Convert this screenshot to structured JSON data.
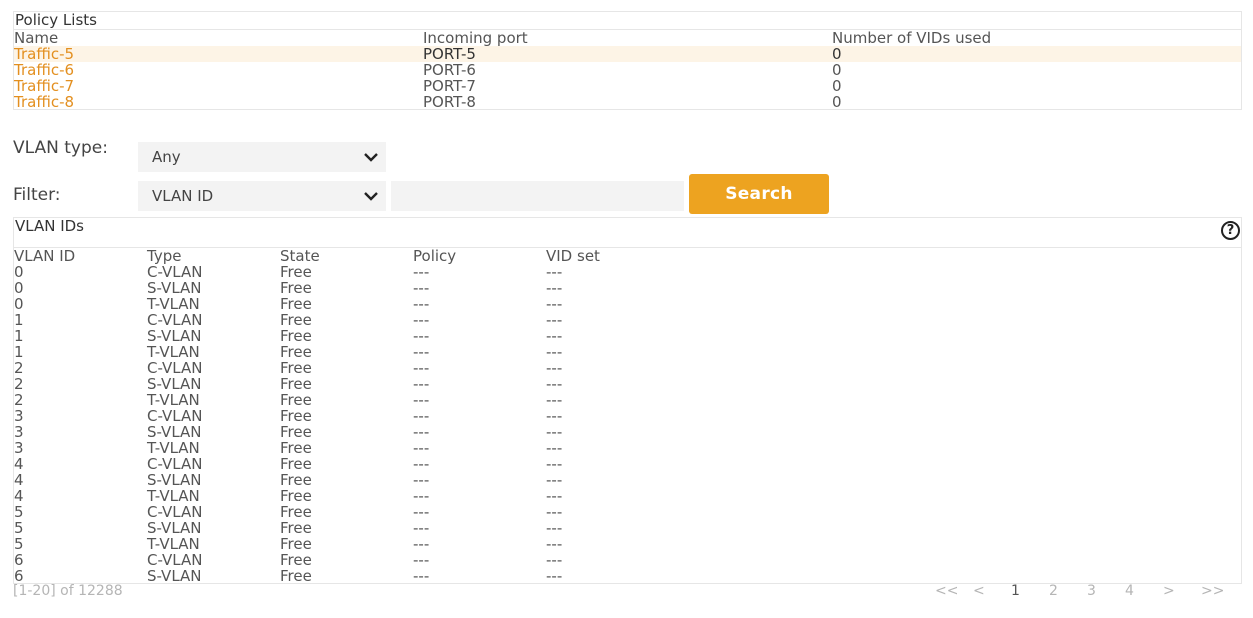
{
  "policy": {
    "title": "Policy Lists",
    "headers": [
      "Name",
      "Incoming port",
      "Number of VIDs used"
    ],
    "rows": [
      {
        "name": "Traffic-5",
        "port": "PORT-5",
        "vids": "0"
      },
      {
        "name": "Traffic-6",
        "port": "PORT-6",
        "vids": "0"
      },
      {
        "name": "Traffic-7",
        "port": "PORT-7",
        "vids": "0"
      },
      {
        "name": "Traffic-8",
        "port": "PORT-8",
        "vids": "0"
      }
    ]
  },
  "form": {
    "vlan_type_label": "VLAN type:",
    "vlan_type_value": "Any",
    "filter_label": "Filter:",
    "filter_value": "VLAN ID",
    "filter_input_value": "",
    "search_label": "Search"
  },
  "vlan": {
    "title": "VLAN IDs",
    "help_icon": "?",
    "headers": [
      "VLAN ID",
      "Type",
      "State",
      "Policy",
      "VID set"
    ],
    "rows": [
      [
        "0",
        "C-VLAN",
        "Free",
        "---",
        "---"
      ],
      [
        "0",
        "S-VLAN",
        "Free",
        "---",
        "---"
      ],
      [
        "0",
        "T-VLAN",
        "Free",
        "---",
        "---"
      ],
      [
        "1",
        "C-VLAN",
        "Free",
        "---",
        "---"
      ],
      [
        "1",
        "S-VLAN",
        "Free",
        "---",
        "---"
      ],
      [
        "1",
        "T-VLAN",
        "Free",
        "---",
        "---"
      ],
      [
        "2",
        "C-VLAN",
        "Free",
        "---",
        "---"
      ],
      [
        "2",
        "S-VLAN",
        "Free",
        "---",
        "---"
      ],
      [
        "2",
        "T-VLAN",
        "Free",
        "---",
        "---"
      ],
      [
        "3",
        "C-VLAN",
        "Free",
        "---",
        "---"
      ],
      [
        "3",
        "S-VLAN",
        "Free",
        "---",
        "---"
      ],
      [
        "3",
        "T-VLAN",
        "Free",
        "---",
        "---"
      ],
      [
        "4",
        "C-VLAN",
        "Free",
        "---",
        "---"
      ],
      [
        "4",
        "S-VLAN",
        "Free",
        "---",
        "---"
      ],
      [
        "4",
        "T-VLAN",
        "Free",
        "---",
        "---"
      ],
      [
        "5",
        "C-VLAN",
        "Free",
        "---",
        "---"
      ],
      [
        "5",
        "S-VLAN",
        "Free",
        "---",
        "---"
      ],
      [
        "5",
        "T-VLAN",
        "Free",
        "---",
        "---"
      ],
      [
        "6",
        "C-VLAN",
        "Free",
        "---",
        "---"
      ],
      [
        "6",
        "S-VLAN",
        "Free",
        "---",
        "---"
      ]
    ]
  },
  "pager": {
    "info": "[1-20] of 12288",
    "first": "<<",
    "prev": "<",
    "pages": [
      "1",
      "2",
      "3",
      "4"
    ],
    "current": "1",
    "next": ">",
    "last": ">>"
  },
  "colors": {
    "accent": "#eda320",
    "link": "#e38f1f",
    "row_highlight": "#fdf4e6"
  }
}
